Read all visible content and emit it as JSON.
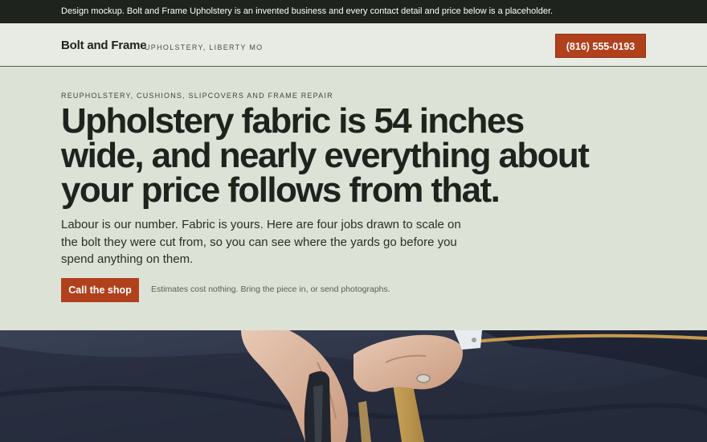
{
  "notice": {
    "text": "Design mockup. Bolt and Frame Upholstery is an invented business and every contact detail and price below is a placeholder."
  },
  "header": {
    "brand": "Bolt and Frame",
    "brand_sub": "UPHOLSTERY, LIBERTY MO",
    "phone": "(816) 555-0193"
  },
  "hero": {
    "eyebrow": "REUPHOLSTERY, CUSHIONS, SLIPCOVERS AND FRAME REPAIR",
    "headline": "Upholstery fabric is 54 inches wide, and nearly everything about your price follows from that.",
    "lede": "Labour is our number. Fabric is yours. Here are four jobs drawn to scale on the bolt they were cut from, so you can see where the yards go before you spend anything on them.",
    "cta_label": "Call the shop",
    "cta_note": "Estimates cost nothing. Bring the piece in, or send photographs."
  },
  "photo": {
    "subject": "hands cutting fabric with scissors beside a measuring rule"
  },
  "colors": {
    "accent": "#b1401d",
    "dark": "#1f231d",
    "hero_bg": "#dde2d6",
    "header_bg": "#e8ebe3"
  }
}
